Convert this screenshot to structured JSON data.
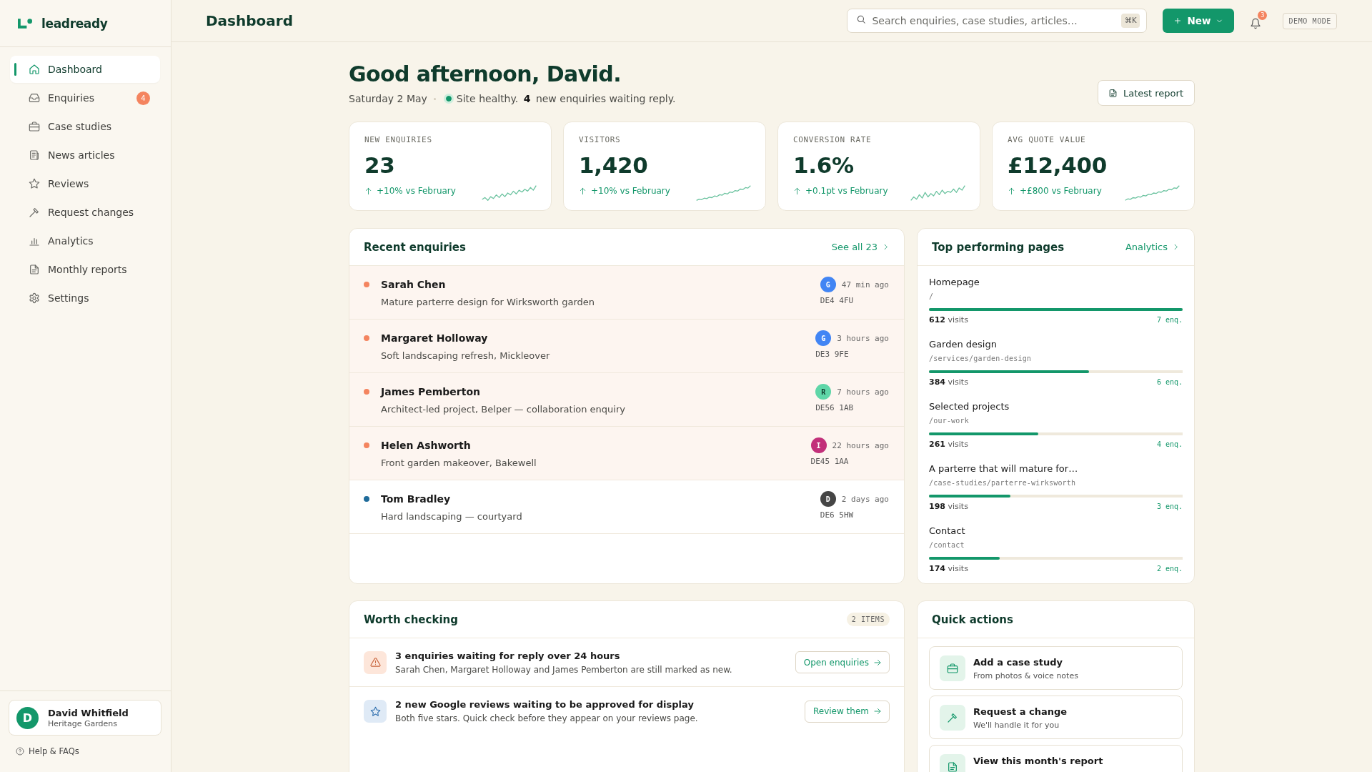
{
  "sidebar": {
    "brand": "leadready",
    "nav": [
      {
        "label": "Dashboard",
        "selected": true
      },
      {
        "label": "Enquiries",
        "selected": false,
        "badge": "4"
      },
      {
        "label": "Case studies",
        "selected": false
      },
      {
        "label": "News articles",
        "selected": false
      },
      {
        "label": "Reviews",
        "selected": false
      },
      {
        "label": "Request changes",
        "selected": false
      },
      {
        "label": "Analytics",
        "selected": false
      },
      {
        "label": "Monthly reports",
        "selected": false
      },
      {
        "label": "Settings",
        "selected": false
      }
    ],
    "user": {
      "initial": "D",
      "name": "David Whitfield",
      "company": "Heritage Gardens"
    },
    "help": "Help & FAQs"
  },
  "topbar": {
    "title": "Dashboard",
    "search": {
      "placeholder": "Search enquiries, case studies, articles…",
      "shortcut": "⌘K"
    },
    "new_button": "New",
    "notifications": "3",
    "mode_badge": "DEMO MODE"
  },
  "greeting": {
    "title": "Good afternoon, David.",
    "date": "Saturday 2 May",
    "status": {
      "healthy": true,
      "text": "Site healthy. **4** new enquiries waiting reply."
    },
    "report_button": "Latest report"
  },
  "stats": [
    {
      "label": "NEW ENQUIRIES",
      "value": "23",
      "rising": true,
      "delta": "+10% vs February"
    },
    {
      "label": "VISITORS",
      "value": "1,420",
      "rising": true,
      "delta": "+10% vs February"
    },
    {
      "label": "CONVERSION RATE",
      "value": "1.6%",
      "rising": true,
      "delta": "+0.1pt vs February"
    },
    {
      "label": "AVG QUOTE VALUE",
      "value": "£12,400",
      "rising": true,
      "delta": "+£800 vs February"
    }
  ],
  "recent_enquiries": {
    "title": "Recent enquiries",
    "link": "See all 23",
    "rows": [
      {
        "name": "Sarah Chen",
        "summary": "Mature parterre design for Wirksworth garden",
        "source": "G",
        "color": "#4285f4",
        "time": "47 min ago",
        "postcode": "DE4 4FU",
        "unread": true
      },
      {
        "name": "Margaret Holloway",
        "summary": "Soft landscaping refresh, Mickleover",
        "source": "G",
        "color": "#4285f4",
        "time": "3 hours ago",
        "postcode": "DE3 9FE",
        "unread": true
      },
      {
        "name": "James Pemberton",
        "summary": "Architect-led project, Belper — collaboration enquiry",
        "source": "R",
        "color": "#5fd6a8",
        "time": "7 hours ago",
        "postcode": "DE56 1AB",
        "unread": true
      },
      {
        "name": "Helen Ashworth",
        "summary": "Front garden makeover, Bakewell",
        "source": "I",
        "color": "#c2307a",
        "time": "22 hours ago",
        "postcode": "DE45 1AA",
        "unread": true
      },
      {
        "name": "Tom Bradley",
        "summary": "Hard landscaping — courtyard",
        "source": "D",
        "color": "#454545",
        "time": "2 days ago",
        "postcode": "DE6 5HW",
        "unread": false
      }
    ]
  },
  "top_pages": {
    "title": "Top performing pages",
    "link": "Analytics",
    "items": [
      {
        "title": "Homepage",
        "path": "/",
        "level": 1,
        "visits": "**612** visits",
        "enquiries": "7 enq."
      },
      {
        "title": "Garden design",
        "path": "/services/garden-design",
        "level": 0.63,
        "visits": "**384** visits",
        "enquiries": "6 enq."
      },
      {
        "title": "Selected projects",
        "path": "/our-work",
        "level": 0.43,
        "visits": "**261** visits",
        "enquiries": "4 enq."
      },
      {
        "title": "A parterre that will mature for…",
        "path": "/case-studies/parterre-wirksworth",
        "level": 0.32,
        "visits": "**198** visits",
        "enquiries": "3 enq."
      },
      {
        "title": "Contact",
        "path": "/contact",
        "level": 0.28,
        "visits": "**174** visits",
        "enquiries": "2 enq."
      }
    ]
  },
  "worth_checking": {
    "title": "Worth checking",
    "count": "2 ITEMS",
    "items": [
      {
        "kind": "alert",
        "title": "3 enquiries waiting for reply over 24 hours",
        "text": "Sarah Chen, Margaret Holloway and James Pemberton are still marked as new.",
        "action": "Open enquiries"
      },
      {
        "kind": "review",
        "title": "2 new Google reviews waiting to be approved for display",
        "text": "Both five stars. Quick check before they appear on your reviews page.",
        "action": "Review them"
      }
    ]
  },
  "quick_actions": {
    "title": "Quick actions",
    "items": [
      {
        "title": "Add a case study",
        "text": "From photos & voice notes"
      },
      {
        "title": "Request a change",
        "text": "We'll handle it for you"
      },
      {
        "title": "View this month's report"
      }
    ]
  }
}
